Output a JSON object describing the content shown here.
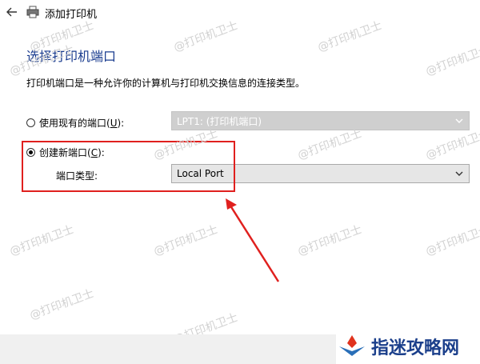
{
  "window": {
    "title": "添加打印机"
  },
  "page": {
    "heading": "选择打印机端口",
    "description": "打印机端口是一种允许你的计算机与打印机交换信息的连接类型。"
  },
  "options": {
    "existing_port": {
      "label_prefix": "使用现有的端口(",
      "hotkey": "U",
      "label_suffix": "):",
      "selected": false,
      "value": "LPT1: (打印机端口)"
    },
    "new_port": {
      "label_prefix": "创建新端口(",
      "hotkey": "C",
      "label_suffix": "):",
      "selected": true
    },
    "port_type": {
      "label": "端口类型:",
      "value": "Local Port"
    }
  },
  "watermark": {
    "text": "@打印机卫士"
  },
  "brand": {
    "text": "指迷攻略网"
  },
  "colors": {
    "heading": "#1a3c8f",
    "highlight": "#e0201e",
    "brand": "#1b3f8b"
  }
}
